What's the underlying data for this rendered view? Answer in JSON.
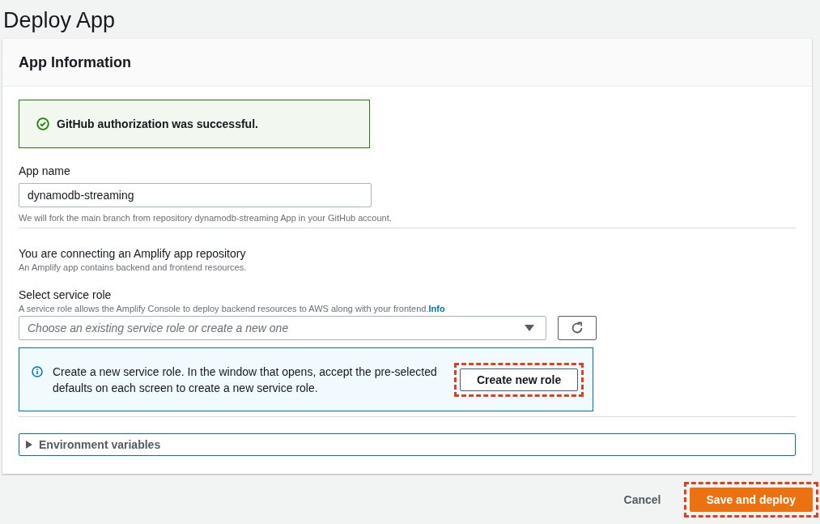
{
  "page_title": "Deploy App",
  "panel": {
    "title": "App Information",
    "alert": {
      "text": "GitHub authorization was successful."
    },
    "app_name": {
      "label": "App name",
      "value": "dynamodb-streaming",
      "hint": "We will fork the main branch from repository dynamodb-streaming App in your GitHub account."
    },
    "connecting": {
      "heading": "You are connecting an Amplify app repository",
      "description": "An Amplify app contains backend and frontend resources."
    },
    "service_role": {
      "label": "Select service role",
      "description": "A service role allows the Amplify Console to deploy backend resources to AWS along with your frontend.",
      "info_link": "Info",
      "placeholder": "Choose an existing service role or create a new one"
    },
    "info_box": {
      "text": "Create a new service role. In the window that opens, accept the pre-selected defaults on each screen to create a new service role.",
      "button": {
        "label": "Create new role",
        "highlighted": true
      }
    },
    "environment_variables": {
      "label": "Environment variables",
      "expanded": false
    }
  },
  "footer": {
    "buttons": [
      {
        "label": "Cancel",
        "kind": "link",
        "highlighted": false
      },
      {
        "label": "Save and deploy",
        "kind": "primary",
        "highlighted": true
      }
    ]
  }
}
